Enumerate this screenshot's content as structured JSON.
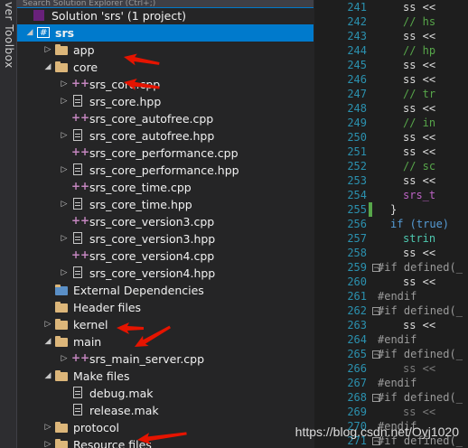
{
  "toolbox": {
    "label": "ver Toolbox"
  },
  "solution_explorer": {
    "search_placeholder": "Search Solution Explorer (Ctrl+;)",
    "items": [
      {
        "label": "Solution 'srs' (1 project)"
      },
      {
        "label": "srs"
      },
      {
        "label": "app"
      },
      {
        "label": "core"
      },
      {
        "label": "srs_core.cpp"
      },
      {
        "label": "srs_core.hpp"
      },
      {
        "label": "srs_core_autofree.cpp"
      },
      {
        "label": "srs_core_autofree.hpp"
      },
      {
        "label": "srs_core_performance.cpp"
      },
      {
        "label": "srs_core_performance.hpp"
      },
      {
        "label": "srs_core_time.cpp"
      },
      {
        "label": "srs_core_time.hpp"
      },
      {
        "label": "srs_core_version3.cpp"
      },
      {
        "label": "srs_core_version3.hpp"
      },
      {
        "label": "srs_core_version4.cpp"
      },
      {
        "label": "srs_core_version4.hpp"
      },
      {
        "label": "External Dependencies"
      },
      {
        "label": "Header files"
      },
      {
        "label": "kernel"
      },
      {
        "label": "main"
      },
      {
        "label": "srs_main_server.cpp"
      },
      {
        "label": "Make files"
      },
      {
        "label": "debug.mak"
      },
      {
        "label": "release.mak"
      },
      {
        "label": "protocol"
      },
      {
        "label": "Resource files"
      }
    ]
  },
  "editor": {
    "line_numbers": [
      "241",
      "242",
      "243",
      "244",
      "245",
      "246",
      "247",
      "248",
      "249",
      "250",
      "251",
      "252",
      "253",
      "254",
      "255",
      "256",
      "257",
      "258",
      "259",
      "260",
      "261",
      "262",
      "263",
      "264",
      "265",
      "266",
      "267",
      "268",
      "269",
      "270",
      "271"
    ],
    "lines": [
      "ss <<",
      "// hs",
      "ss <<",
      "// hp",
      "ss <<",
      "ss <<",
      "// tr",
      "ss <<",
      "// in",
      "ss <<",
      "ss <<",
      "// sc",
      "ss <<",
      "srs_t",
      "}",
      "if (true)",
      "strin",
      "ss <<",
      "#if defined(_",
      "ss <<",
      "#endif",
      "#if defined(_",
      "ss <<",
      "#endif",
      "#if defined(_",
      "ss <<",
      "#endif",
      "#if defined(_",
      "ss <<",
      "#endif",
      "#if defined(_"
    ]
  },
  "watermark": "https://blog.csdn.net/Oyj1020"
}
